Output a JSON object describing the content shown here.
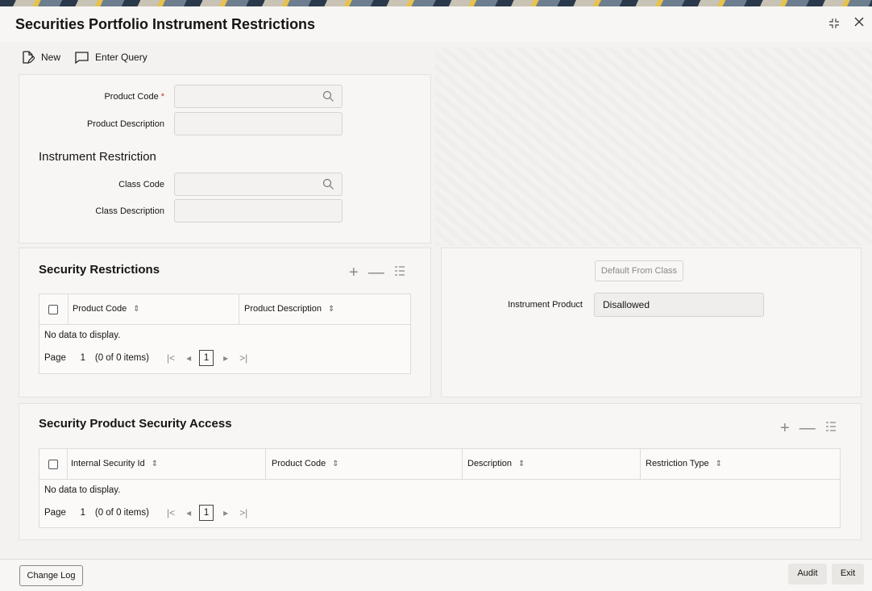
{
  "window": {
    "title": "Securities Portfolio Instrument Restrictions",
    "shrink_icon": "shrink-icon",
    "close_icon": "close-icon"
  },
  "toolbar": {
    "new_label": "New",
    "enter_query_label": "Enter Query"
  },
  "product": {
    "code_label": "Product Code",
    "required_marker": "*",
    "code_value": "",
    "description_label": "Product Description",
    "description_value": ""
  },
  "instrument_restriction": {
    "heading": "Instrument Restriction",
    "class_code_label": "Class Code",
    "class_code_value": "",
    "class_description_label": "Class Description",
    "class_description_value": ""
  },
  "security_restrictions": {
    "heading": "Security Restrictions",
    "columns": [
      "Product Code",
      "Product Description"
    ],
    "empty_text": "No data to display.",
    "page_label": "Page",
    "page_value": "1",
    "items_info": "(0 of 0 items)",
    "current_page": "1"
  },
  "instrument": {
    "default_button": "Default From Class",
    "product_label": "Instrument Product",
    "product_value": "Disallowed"
  },
  "security_access": {
    "heading": "Security Product Security Access",
    "columns": [
      "Internal Security Id",
      "Product Code",
      "Description",
      "Restriction Type"
    ],
    "empty_text": "No data to display.",
    "page_label": "Page",
    "page_value": "1",
    "items_info": "(0 of 0 items)",
    "current_page": "1"
  },
  "footer": {
    "change_log": "Change Log",
    "audit": "Audit",
    "exit": "Exit"
  }
}
